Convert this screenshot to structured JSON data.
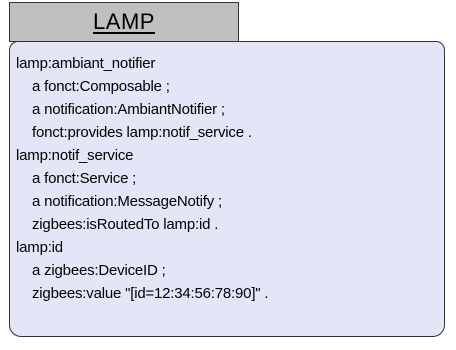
{
  "header": {
    "title": "LAMP"
  },
  "colors": {
    "header_fill": "#c0c0c0",
    "body_fill": "#e4e6f7",
    "border": "#333333"
  },
  "lines": [
    {
      "text": "lamp:ambiant_notifier",
      "indent": false
    },
    {
      "text": "a fonct:Composable ;",
      "indent": true
    },
    {
      "text": "a notification:AmbiantNotifier ;",
      "indent": true
    },
    {
      "text": "fonct:provides lamp:notif_service .",
      "indent": true
    },
    {
      "text": "lamp:notif_service",
      "indent": false
    },
    {
      "text": "a fonct:Service ;",
      "indent": true
    },
    {
      "text": "a notification:MessageNotify ;",
      "indent": true
    },
    {
      "text": "zigbees:isRoutedTo lamp:id .",
      "indent": true
    },
    {
      "text": "lamp:id",
      "indent": false
    },
    {
      "text": "a zigbees:DeviceID ;",
      "indent": true
    },
    {
      "text": "zigbees:value \"[id=12:34:56:78:90]\" .",
      "indent": true
    }
  ]
}
